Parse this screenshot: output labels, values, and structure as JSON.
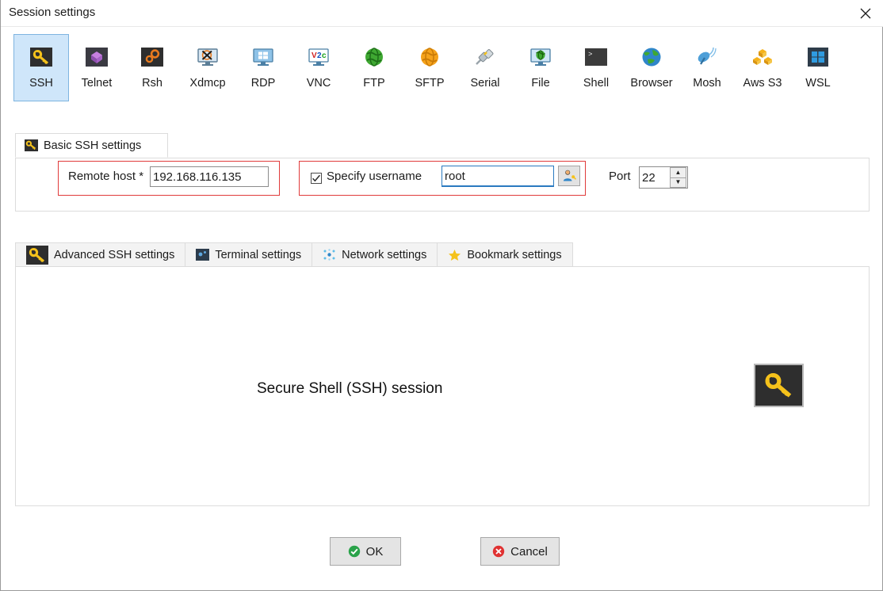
{
  "window": {
    "title": "Session settings",
    "close_label": "×"
  },
  "session_types": [
    {
      "label": "SSH",
      "icon": "ssh-key-icon",
      "selected": true
    },
    {
      "label": "Telnet",
      "icon": "telnet-cube-icon",
      "selected": false
    },
    {
      "label": "Rsh",
      "icon": "rsh-gears-icon",
      "selected": false
    },
    {
      "label": "Xdmcp",
      "icon": "xdmcp-x-icon",
      "selected": false
    },
    {
      "label": "RDP",
      "icon": "rdp-monitor-icon",
      "selected": false
    },
    {
      "label": "VNC",
      "icon": "vnc-monitor-icon",
      "selected": false
    },
    {
      "label": "FTP",
      "icon": "ftp-globe-icon",
      "selected": false
    },
    {
      "label": "SFTP",
      "icon": "sftp-globe-icon",
      "selected": false
    },
    {
      "label": "Serial",
      "icon": "serial-plug-icon",
      "selected": false
    },
    {
      "label": "File",
      "icon": "file-monitor-icon",
      "selected": false
    },
    {
      "label": "Shell",
      "icon": "shell-prompt-icon",
      "selected": false
    },
    {
      "label": "Browser",
      "icon": "browser-globe-icon",
      "selected": false
    },
    {
      "label": "Mosh",
      "icon": "mosh-dish-icon",
      "selected": false
    },
    {
      "label": "Aws S3",
      "icon": "aws-s3-icon",
      "selected": false
    },
    {
      "label": "WSL",
      "icon": "wsl-windows-icon",
      "selected": false
    }
  ],
  "basic_panel": {
    "tab_label": "Basic SSH settings",
    "tab_icon": "ssh-key-icon",
    "remote_host": {
      "label": "Remote host *",
      "value": "192.168.116.135",
      "placeholder": ""
    },
    "specify_username": {
      "label": "Specify username",
      "checked": true,
      "check_glyph": "✓",
      "value": "root",
      "placeholder": "",
      "picker_icon": "user-key-icon"
    },
    "port": {
      "label": "Port",
      "value": "22",
      "up_glyph": "▲",
      "down_glyph": "▼"
    },
    "highlight_color": "#e03a3a"
  },
  "sub_tabs": [
    {
      "label": "Advanced SSH settings",
      "icon": "ssh-key-icon",
      "active": false
    },
    {
      "label": "Terminal settings",
      "icon": "terminal-icon",
      "active": false
    },
    {
      "label": "Network settings",
      "icon": "network-dots-icon",
      "active": false
    },
    {
      "label": "Bookmark settings",
      "icon": "star-icon",
      "active": false
    }
  ],
  "content": {
    "text": "Secure Shell (SSH) session",
    "icon": "ssh-key-large-icon"
  },
  "buttons": {
    "ok_label": "OK",
    "ok_icon": "green-check-icon",
    "cancel_label": "Cancel",
    "cancel_icon": "red-x-icon"
  },
  "colors": {
    "selected_tab_bg": "#cfe6fa",
    "selected_tab_border": "#7eb4e0",
    "highlight_red": "#e03a3a",
    "focus_blue": "#2a7ac0",
    "key_yellow": "#f5c21b",
    "icon_dark": "#2e2e2e"
  }
}
